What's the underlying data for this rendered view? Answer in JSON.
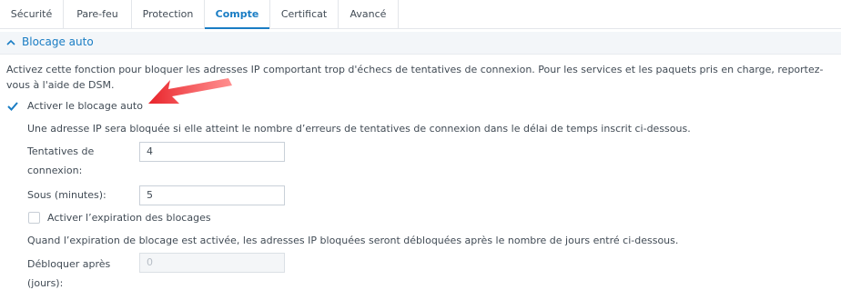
{
  "tabs": [
    {
      "label": "Sécurité",
      "active": false
    },
    {
      "label": "Pare-feu",
      "active": false
    },
    {
      "label": "Protection",
      "active": false
    },
    {
      "label": "Compte",
      "active": true
    },
    {
      "label": "Certificat",
      "active": false
    },
    {
      "label": "Avancé",
      "active": false
    }
  ],
  "section": {
    "title": "Blocage auto",
    "expanded": true
  },
  "description": "Activez cette fonction pour bloquer les adresses IP comportant trop d'échecs de tentatives de connexion. Pour les services et les paquets pris en charge, reportez-vous à l'aide de DSM.",
  "enable_autoblock": {
    "label": "Activer le blocage auto",
    "checked": true
  },
  "autoblock_info": "Une adresse IP sera bloquée si elle atteint le nombre d’erreurs de tentatives de connexion dans le délai de temps inscrit ci-dessous.",
  "attempts": {
    "label_line1": "Tentatives de",
    "label_line2": "connexion:",
    "value": "4"
  },
  "within": {
    "label": "Sous (minutes):",
    "value": "5"
  },
  "enable_expiration": {
    "label": "Activer l’expiration des blocages",
    "checked": false
  },
  "expiration_info": "Quand l’expiration de blocage est activée, les adresses IP bloquées seront débloquées après le nombre de jours entré ci-dessous.",
  "unblock_after": {
    "label_line1": "Débloquer après",
    "label_line2": "(jours):",
    "value": "0",
    "disabled": true
  },
  "colors": {
    "accent": "#1a7dc4",
    "arrow": "#e8232a",
    "header_bg": "#f3f6f9"
  },
  "icons": {
    "section_toggle": "chevron-up-icon",
    "pointer": "red-arrow-annotation"
  }
}
